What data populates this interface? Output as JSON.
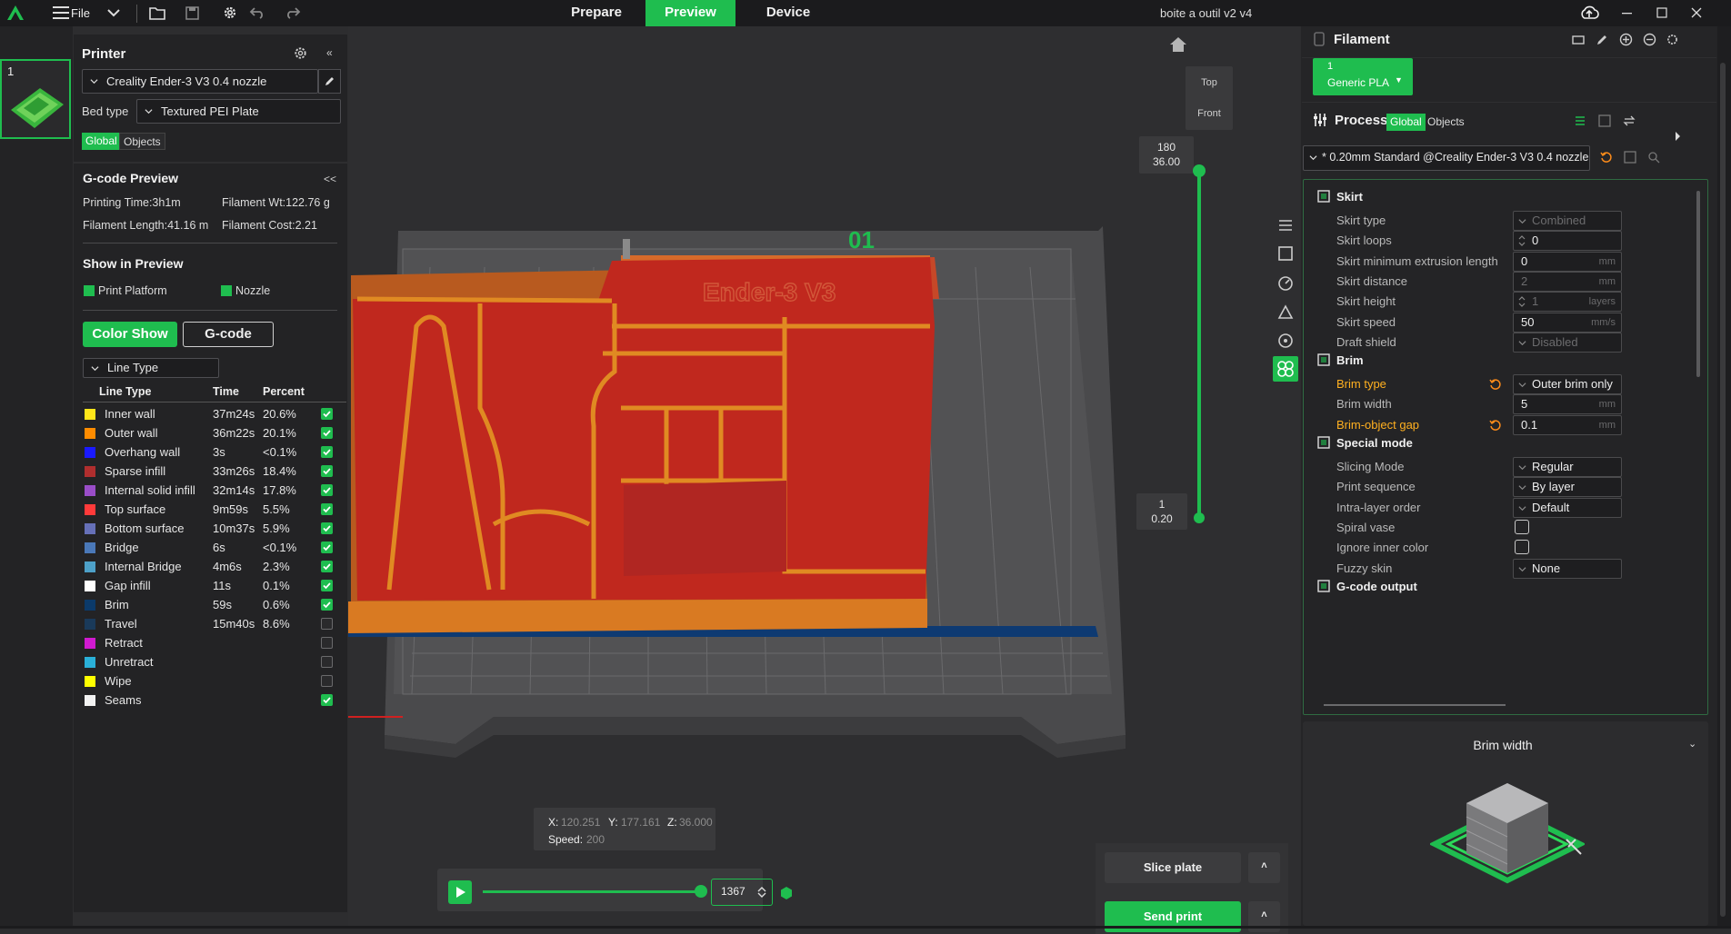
{
  "window": {
    "title": "boite a outil v2 v4",
    "menu_file": "File",
    "tabs": [
      "Prepare",
      "Preview",
      "Device"
    ],
    "active_tab": "Preview"
  },
  "plate_list": {
    "plate_number": "1"
  },
  "printer": {
    "header": "Printer",
    "printer_name": "Creality Ender-3 V3 0.4 nozzle",
    "bed_type_label": "Bed type",
    "bed_type_value": "Textured PEI Plate",
    "toggle_global": "Global",
    "toggle_objects": "Objects"
  },
  "gcode_preview": {
    "header": "G-code Preview",
    "collapse": "<<",
    "printing_time": "Printing Time:3h1m",
    "filament_wt": "Filament Wt:122.76 g",
    "filament_length": "Filament Length:41.16 m",
    "filament_cost": "Filament Cost:2.21"
  },
  "show_in_preview": {
    "header": "Show in Preview",
    "print_platform": "Print Platform",
    "nozzle": "Nozzle",
    "color_show": "Color Show",
    "gcode": "G-code",
    "view_type": "Line Type"
  },
  "line_table": {
    "headers": [
      "Line Type",
      "Time",
      "Percent"
    ],
    "rows": [
      {
        "name": "Inner wall",
        "time": "37m24s",
        "percent": "20.6%",
        "color": "#ffe61a",
        "checked": true
      },
      {
        "name": "Outer wall",
        "time": "36m22s",
        "percent": "20.1%",
        "color": "#ff8c00",
        "checked": true
      },
      {
        "name": "Overhang wall",
        "time": "3s",
        "percent": "<0.1%",
        "color": "#1a1aff",
        "checked": true
      },
      {
        "name": "Sparse infill",
        "time": "33m26s",
        "percent": "18.4%",
        "color": "#b02e2e",
        "checked": true
      },
      {
        "name": "Internal solid infill",
        "time": "32m14s",
        "percent": "17.8%",
        "color": "#9a4dc8",
        "checked": true
      },
      {
        "name": "Top surface",
        "time": "9m59s",
        "percent": "5.5%",
        "color": "#ff3a3a",
        "checked": true
      },
      {
        "name": "Bottom surface",
        "time": "10m37s",
        "percent": "5.9%",
        "color": "#6670b8",
        "checked": true
      },
      {
        "name": "Bridge",
        "time": "6s",
        "percent": "<0.1%",
        "color": "#4a78b8",
        "checked": true
      },
      {
        "name": "Internal Bridge",
        "time": "4m6s",
        "percent": "2.3%",
        "color": "#4da0c8",
        "checked": true
      },
      {
        "name": "Gap infill",
        "time": "11s",
        "percent": "0.1%",
        "color": "#ffffff",
        "checked": true
      },
      {
        "name": "Brim",
        "time": "59s",
        "percent": "0.6%",
        "color": "#0b3a6a",
        "checked": true
      },
      {
        "name": "Travel",
        "time": "15m40s",
        "percent": "8.6%",
        "color": "#1a3a5a",
        "checked": false
      },
      {
        "name": "Retract",
        "time": "",
        "percent": "",
        "color": "#d01ad0",
        "checked": false
      },
      {
        "name": "Unretract",
        "time": "",
        "percent": "",
        "color": "#2ab0d8",
        "checked": false
      },
      {
        "name": "Wipe",
        "time": "",
        "percent": "",
        "color": "#ffff00",
        "checked": false
      },
      {
        "name": "Seams",
        "time": "",
        "percent": "",
        "color": "#f2f2f2",
        "checked": true
      }
    ]
  },
  "viewport": {
    "view_top": "Top",
    "view_front": "Front",
    "model_label": "01",
    "model_text": "Ender-3 V3",
    "layer_top_num": "180",
    "layer_top_height": "36.00",
    "layer_bottom_num": "1",
    "layer_bottom_height": "0.20",
    "coords": {
      "x_label": "X:",
      "x": "120.251",
      "y_label": "Y:",
      "y": "177.161",
      "z_label": "Z:",
      "z": "36.000",
      "speed_label": "Speed:",
      "speed": "200"
    },
    "move_value": "1367",
    "slice_plate": "Slice plate",
    "send_print": "Send print"
  },
  "filament": {
    "header": "Filament",
    "slot_number": "1",
    "slot_name": "Generic PLA"
  },
  "process": {
    "header": "Process",
    "toggle_global": "Global",
    "toggle_objects": "Objects",
    "preset": "* 0.20mm Standard  @Creality Ender-3 V3 0.4 nozzle"
  },
  "settings": {
    "skirt_header": "Skirt",
    "skirt": [
      {
        "label": "Skirt type",
        "value": "Combined",
        "kind": "dropdown",
        "disabled": true,
        "unit": ""
      },
      {
        "label": "Skirt loops",
        "value": "0",
        "kind": "spin",
        "disabled": false,
        "unit": ""
      },
      {
        "label": "Skirt minimum extrusion length",
        "value": "0",
        "kind": "text",
        "disabled": false,
        "unit": "mm"
      },
      {
        "label": "Skirt distance",
        "value": "2",
        "kind": "text",
        "disabled": true,
        "unit": "mm"
      },
      {
        "label": "Skirt height",
        "value": "1",
        "kind": "spin",
        "disabled": true,
        "unit": "layers"
      },
      {
        "label": "Skirt speed",
        "value": "50",
        "kind": "text",
        "disabled": false,
        "unit": "mm/s"
      },
      {
        "label": "Draft shield",
        "value": "Disabled",
        "kind": "dropdown",
        "disabled": true,
        "unit": ""
      }
    ],
    "brim_header": "Brim",
    "brim": [
      {
        "label": "Brim type",
        "value": "Outer brim only",
        "kind": "dropdown",
        "disabled": false,
        "unit": "",
        "modified": true
      },
      {
        "label": "Brim width",
        "value": "5",
        "kind": "text",
        "disabled": false,
        "unit": "mm",
        "modified": false
      },
      {
        "label": "Brim-object gap",
        "value": "0.1",
        "kind": "text",
        "disabled": false,
        "unit": "mm",
        "modified": true
      }
    ],
    "special_header": "Special mode",
    "special": [
      {
        "label": "Slicing Mode",
        "value": "Regular",
        "kind": "dropdown"
      },
      {
        "label": "Print sequence",
        "value": "By layer",
        "kind": "dropdown"
      },
      {
        "label": "Intra-layer order",
        "value": "Default",
        "kind": "dropdown"
      },
      {
        "label": "Spiral vase",
        "value": "",
        "kind": "check"
      },
      {
        "label": "Ignore inner color",
        "value": "",
        "kind": "check"
      },
      {
        "label": "Fuzzy skin",
        "value": "None",
        "kind": "dropdown"
      }
    ],
    "gcode_output_header": "G-code output"
  },
  "help": {
    "title": "Brim width"
  },
  "colors": {
    "accent": "#1fbd4f",
    "modified": "#ffb020",
    "model_red": "#c0281e",
    "model_orange": "#e08a22"
  }
}
